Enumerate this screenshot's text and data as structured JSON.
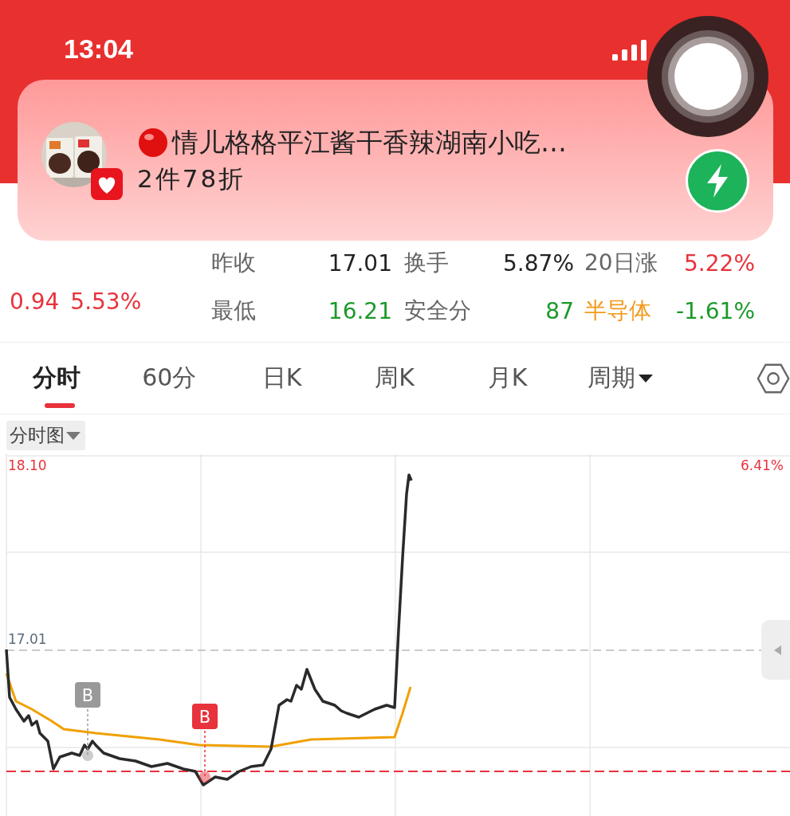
{
  "status_bar": {
    "time": "13:04"
  },
  "notification": {
    "title": "情儿格格平江酱干香辣湖南小吃…",
    "subtitle": "2件78折"
  },
  "quote": {
    "change": "0.94",
    "change_percent": "5.53%",
    "stats": [
      {
        "kind": "metric",
        "label": "昨收",
        "value": "17.01",
        "color": "#222222"
      },
      {
        "kind": "metric",
        "label": "换手",
        "value": "5.87%",
        "color": "#222222"
      },
      {
        "kind": "metric",
        "label": "20日涨",
        "value": "5.22%",
        "color": "#e8323c"
      },
      {
        "kind": "metric",
        "label": "最低",
        "value": "16.21",
        "color": "#1a9a2a"
      },
      {
        "kind": "metric",
        "label": "安全分",
        "value": "87",
        "color": "#1a9a2a"
      },
      {
        "kind": "sector",
        "label": "半导体",
        "value": "-1.61%",
        "color": "#1a9a2a"
      }
    ]
  },
  "tabs": [
    {
      "label": "分时",
      "selected": true,
      "kind": "tab"
    },
    {
      "label": "60分",
      "selected": false,
      "kind": "tab"
    },
    {
      "label": "日K",
      "selected": false,
      "kind": "tab"
    },
    {
      "label": "周K",
      "selected": false,
      "kind": "tab"
    },
    {
      "label": "月K",
      "selected": false,
      "kind": "tab"
    },
    {
      "label": "周期",
      "selected": false,
      "kind": "dropdown"
    }
  ],
  "chart_mode": {
    "label": "分时图"
  },
  "chart": {
    "high_price": "18.10",
    "high_change": "6.41%",
    "previous_close": "17.01",
    "markers": [
      {
        "text": "B",
        "color": "#999999"
      },
      {
        "text": "B",
        "color": "#e8323c"
      }
    ]
  }
}
